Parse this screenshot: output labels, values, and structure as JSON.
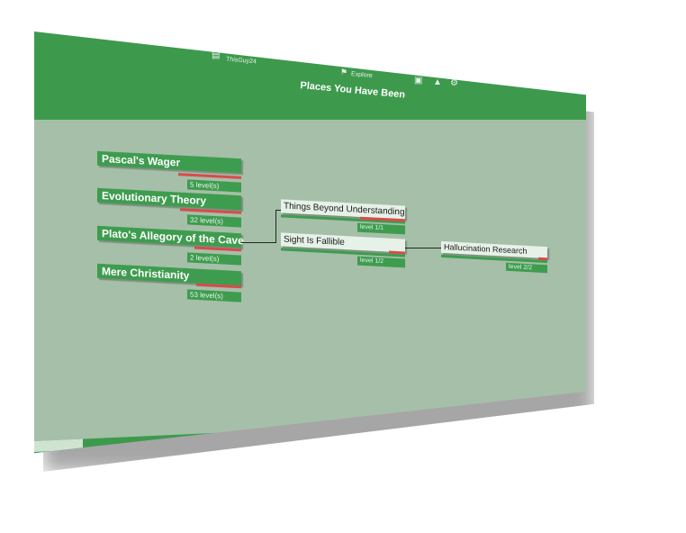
{
  "header": {
    "username": "ThisGuy24",
    "explore_label": "Explore",
    "page_title": "Places You Have Been",
    "icons": [
      "user-icon",
      "explore-icon",
      "inventory-icon",
      "hierarchy-icon",
      "settings-gear-icon"
    ]
  },
  "colors": {
    "primary_green": "#3e9c4f",
    "background": "#a6bfa9",
    "progress_red": "#d94b4b",
    "light_card": "#e6f1e7"
  },
  "topics": [
    {
      "title": "Pascal's Wager",
      "levels": "5 level(s)"
    },
    {
      "title": "Evolutionary Theory",
      "levels": "32 level(s)"
    },
    {
      "title": "Plato's Allegory of the Cave",
      "levels": "2 level(s)"
    },
    {
      "title": "Mere Christianity",
      "levels": "53 level(s)"
    }
  ],
  "levels": [
    {
      "title": "Things Beyond Understanding",
      "level": "level 1/1"
    },
    {
      "title": "Sight Is Fallible",
      "level": "level 1/2"
    },
    {
      "title": "Hallucination Research",
      "level": "level 2/2"
    }
  ]
}
